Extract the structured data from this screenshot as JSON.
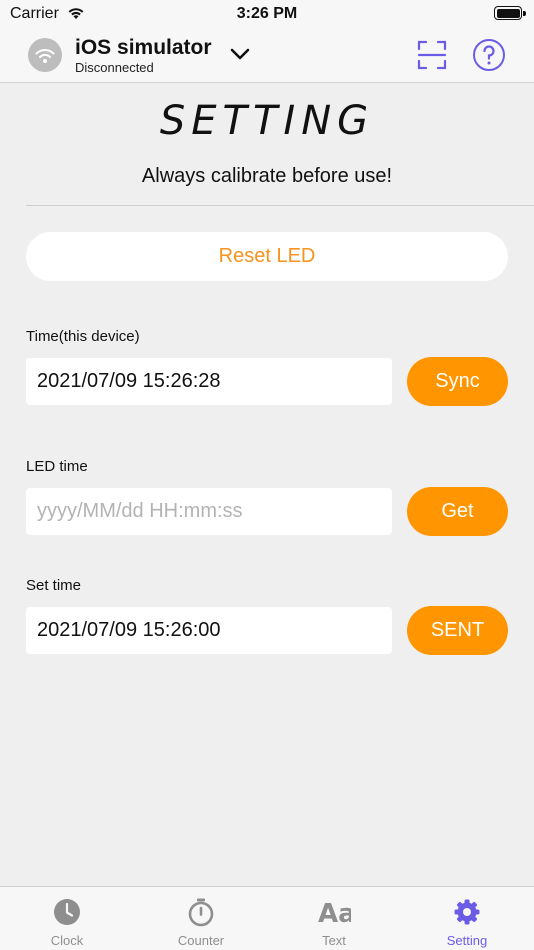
{
  "status_bar": {
    "carrier": "Carrier",
    "time": "3:26 PM"
  },
  "nav": {
    "device_name": "iOS simulator",
    "connection_status": "Disconnected",
    "accent_color": "#6b5ce7"
  },
  "page": {
    "title": "SETTING",
    "subtitle": "Always calibrate before use!",
    "reset_label": "Reset LED"
  },
  "fields": {
    "device_time": {
      "label": "Time(this device)",
      "value": "2021/07/09 15:26:28",
      "button_label": "Sync"
    },
    "led_time": {
      "label": "LED time",
      "value": "",
      "placeholder": "yyyy/MM/dd HH:mm:ss",
      "button_label": "Get"
    },
    "set_time": {
      "label": "Set time",
      "value": "2021/07/09 15:26:00",
      "button_label": "SENT"
    }
  },
  "colors": {
    "button_orange": "#ff9500",
    "reset_text_orange": "#f7931e",
    "tab_active": "#6b5ce7",
    "tab_inactive": "#8e8e8e"
  },
  "tabs": [
    {
      "label": "Clock",
      "icon": "clock-icon",
      "active": false
    },
    {
      "label": "Counter",
      "icon": "stopwatch-icon",
      "active": false
    },
    {
      "label": "Text",
      "icon": "text-aa-icon",
      "active": false
    },
    {
      "label": "Setting",
      "icon": "gear-icon",
      "active": true
    }
  ]
}
